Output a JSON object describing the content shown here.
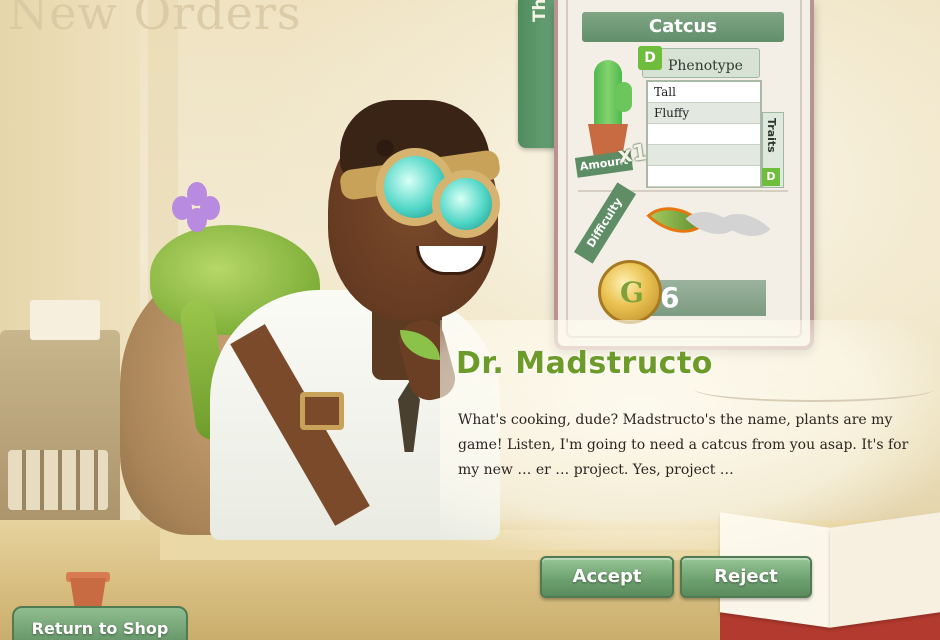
{
  "background": {
    "title": "New Orders"
  },
  "order": {
    "tab_label": "The Order",
    "plant_name": "Catcus",
    "amount_label": "Amount",
    "amount_value": "x1",
    "phenotype": {
      "icon_letter": "D",
      "header": "Phenotype",
      "traits": [
        "Tall",
        "Fluffy",
        "",
        "",
        ""
      ]
    },
    "traits_tab_label": "Traits",
    "traits_icon_letter": "D",
    "difficulty": {
      "label": "Difficulty",
      "level": 1,
      "max": 3
    },
    "reward": {
      "coin_letter": "G",
      "value": "6"
    }
  },
  "dialogue": {
    "speaker": "Dr. Madstructo",
    "text": "What's cooking, dude? Madstructo's the name, plants are my game! Listen, I'm going to need a catcus from you asap. It's for my new … er … project. Yes, project …"
  },
  "buttons": {
    "accept": "Accept",
    "reject": "Reject",
    "return_to_shop": "Return to Shop"
  },
  "colors": {
    "accent_green": "#6c9b29",
    "button_green": "#6c9f6e",
    "difficulty_leaf_active": "#e8760f"
  }
}
